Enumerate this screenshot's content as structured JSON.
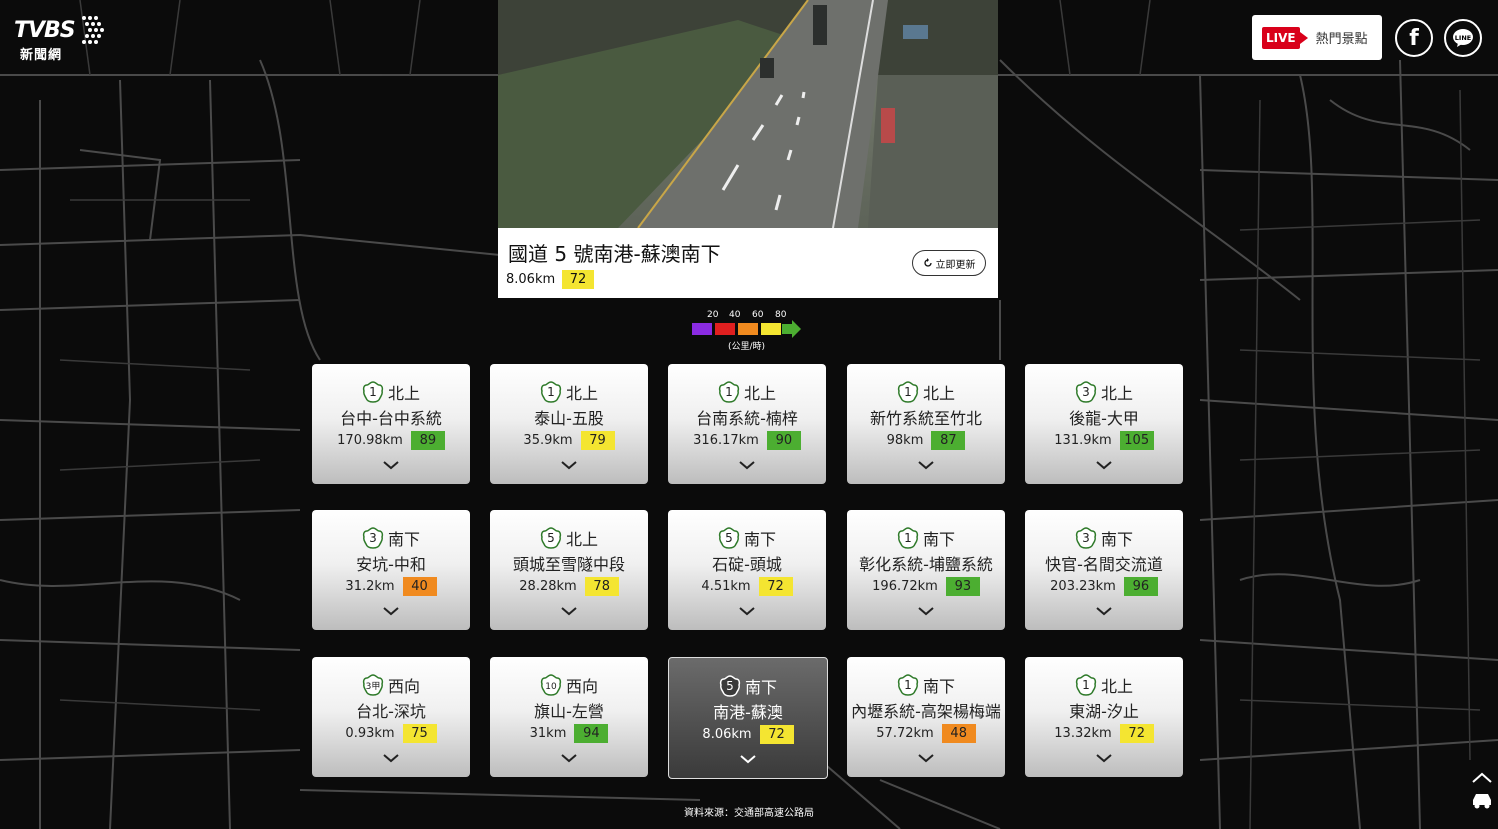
{
  "header": {
    "logo_text": "TVBS",
    "logo_sub": "新聞網",
    "live_badge": "LIVE",
    "live_label": "熱門景點",
    "facebook_glyph": "f",
    "line_glyph": "LINE"
  },
  "camera": {
    "title": "國道 5 號南港-蘇澳南下",
    "distance": "8.06km",
    "speed": "72",
    "speed_color": "#f4e531",
    "refresh_label": "立即更新"
  },
  "legend": {
    "ticks": [
      "20",
      "40",
      "60",
      "80"
    ],
    "unit": "(公里/時)",
    "colors": [
      "#8a2be2",
      "#e01f1f",
      "#f08a1f",
      "#f4e531",
      "#4cae31"
    ]
  },
  "routes": [
    {
      "highway": "1",
      "direction": "北上",
      "name": "台中-台中系統",
      "distance": "170.98km",
      "speed": "89",
      "color": "#4cae31"
    },
    {
      "highway": "1",
      "direction": "北上",
      "name": "泰山-五股",
      "distance": "35.9km",
      "speed": "79",
      "color": "#f4e531"
    },
    {
      "highway": "1",
      "direction": "北上",
      "name": "台南系統-楠梓",
      "distance": "316.17km",
      "speed": "90",
      "color": "#4cae31"
    },
    {
      "highway": "1",
      "direction": "北上",
      "name": "新竹系統至竹北",
      "distance": "98km",
      "speed": "87",
      "color": "#4cae31"
    },
    {
      "highway": "3",
      "direction": "北上",
      "name": "後龍-大甲",
      "distance": "131.9km",
      "speed": "105",
      "color": "#4cae31"
    },
    {
      "highway": "3",
      "direction": "南下",
      "name": "安坑-中和",
      "distance": "31.2km",
      "speed": "40",
      "color": "#f08a1f"
    },
    {
      "highway": "5",
      "direction": "北上",
      "name": "頭城至雪隧中段",
      "distance": "28.28km",
      "speed": "78",
      "color": "#f4e531"
    },
    {
      "highway": "5",
      "direction": "南下",
      "name": "石碇-頭城",
      "distance": "4.51km",
      "speed": "72",
      "color": "#f4e531"
    },
    {
      "highway": "1",
      "direction": "南下",
      "name": "彰化系統-埔鹽系統",
      "distance": "196.72km",
      "speed": "93",
      "color": "#4cae31"
    },
    {
      "highway": "3",
      "direction": "南下",
      "name": "快官-名間交流道",
      "distance": "203.23km",
      "speed": "96",
      "color": "#4cae31"
    },
    {
      "highway": "3甲",
      "direction": "西向",
      "name": "台北-深坑",
      "distance": "0.93km",
      "speed": "75",
      "color": "#f4e531"
    },
    {
      "highway": "10",
      "direction": "西向",
      "name": "旗山-左營",
      "distance": "31km",
      "speed": "94",
      "color": "#4cae31"
    },
    {
      "highway": "5",
      "direction": "南下",
      "name": "南港-蘇澳",
      "distance": "8.06km",
      "speed": "72",
      "color": "#f4e531",
      "selected": true
    },
    {
      "highway": "1",
      "direction": "南下",
      "name": "內壢系統-高架楊梅端",
      "distance": "57.72km",
      "speed": "48",
      "color": "#f08a1f"
    },
    {
      "highway": "1",
      "direction": "北上",
      "name": "東湖-汐止",
      "distance": "13.32km",
      "speed": "72",
      "color": "#f4e531"
    }
  ],
  "footer": {
    "source": "資料來源：交通部高速公路局"
  }
}
